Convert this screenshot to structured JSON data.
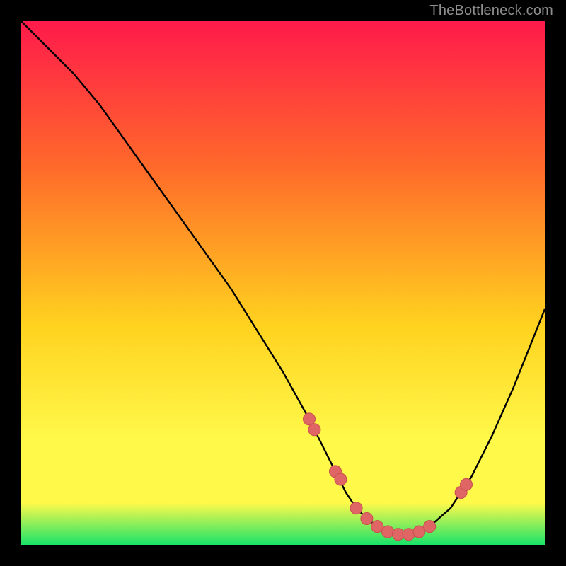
{
  "watermark": "TheBottleneck.com",
  "colors": {
    "background": "#000000",
    "curve_stroke": "#000000",
    "marker_fill": "#e06666",
    "marker_stroke": "#c94f4f",
    "gradient_top": "#ff1a4b",
    "gradient_mid1": "#ff6a2a",
    "gradient_mid2": "#ffd21f",
    "gradient_mid3": "#fff94a",
    "gradient_bottom": "#19e36a"
  },
  "chart_data": {
    "type": "line",
    "title": "",
    "xlabel": "",
    "ylabel": "",
    "xlim": [
      0,
      100
    ],
    "ylim": [
      0,
      100
    ],
    "grid": false,
    "legend": false,
    "series": [
      {
        "name": "curve",
        "x": [
          0,
          3,
          6,
          10,
          15,
          20,
          25,
          30,
          35,
          40,
          45,
          50,
          55,
          58,
          60,
          62,
          64,
          66,
          68,
          70,
          72,
          74,
          76,
          78,
          82,
          86,
          90,
          94,
          98,
          100
        ],
        "y": [
          100,
          97,
          94,
          90,
          84,
          77,
          70,
          63,
          56,
          49,
          41,
          33,
          24,
          18,
          14,
          10,
          7,
          5,
          3.5,
          2.5,
          2,
          2,
          2.5,
          3.5,
          7,
          13,
          21,
          30,
          40,
          45
        ]
      }
    ],
    "markers": {
      "name": "highlight-points",
      "x": [
        55,
        56,
        60,
        61,
        64,
        66,
        68,
        70,
        72,
        74,
        76,
        78,
        84,
        85
      ],
      "y": [
        24,
        22,
        14,
        12.5,
        7,
        5,
        3.5,
        2.5,
        2,
        2,
        2.5,
        3.5,
        10,
        11.5
      ]
    }
  }
}
